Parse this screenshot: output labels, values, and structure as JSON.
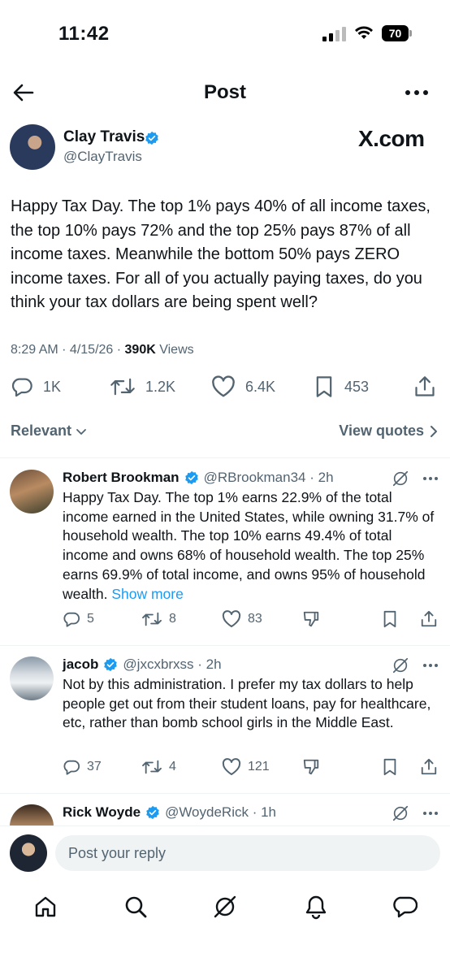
{
  "status_bar": {
    "time": "11:42",
    "battery": "70"
  },
  "header": {
    "title": "Post"
  },
  "post": {
    "author_name": "Clay Travis",
    "author_handle": "@ClayTravis",
    "watermark": "X.com",
    "text": "Happy Tax Day. The top 1% pays 40% of all income taxes, the top 10% pays 72% and the top 25% pays 87% of all income taxes. Meanwhile the bottom 50% pays ZERO income taxes. For all of you actually paying taxes, do you think your tax dollars are being spent well?",
    "meta_time": "8:29 AM · 4/15/26 · ",
    "views_count": "390K",
    "views_label": " Views",
    "replies": "1K",
    "reposts": "1.2K",
    "likes": "6.4K",
    "bookmarks": "453"
  },
  "filters": {
    "sort_label": "Relevant",
    "quotes_label": "View quotes"
  },
  "replies": [
    {
      "name": "Robert Brookman",
      "handle": "@RBrookman34 · 2h",
      "text": "Happy Tax Day. The top 1% earns 22.9% of the total income earned in the United States, while owning 31.7% of household wealth.  The top 10% earns 49.4% of total income and owns 68% of household wealth. The top 25% earns 69.9% of total income, and owns 95% of household wealth.",
      "show_more": "Show more",
      "replies": "5",
      "reposts": "8",
      "likes": "83"
    },
    {
      "name": "jacob",
      "handle": "@jxcxbrxss · 2h",
      "text": "Not by this administration. I prefer my tax dollars to help people get out from their student loans, pay for healthcare, etc, rather than bomb school girls in the Middle East.",
      "replies": "37",
      "reposts": "4",
      "likes": "121"
    },
    {
      "name": "Rick Woyde",
      "handle": "@WoydeRick · 1h"
    }
  ],
  "reply_bar": {
    "placeholder": "Post your reply"
  },
  "colors": {
    "text": "#0f1419",
    "secondary": "#536471",
    "accent": "#1d9bf0"
  }
}
